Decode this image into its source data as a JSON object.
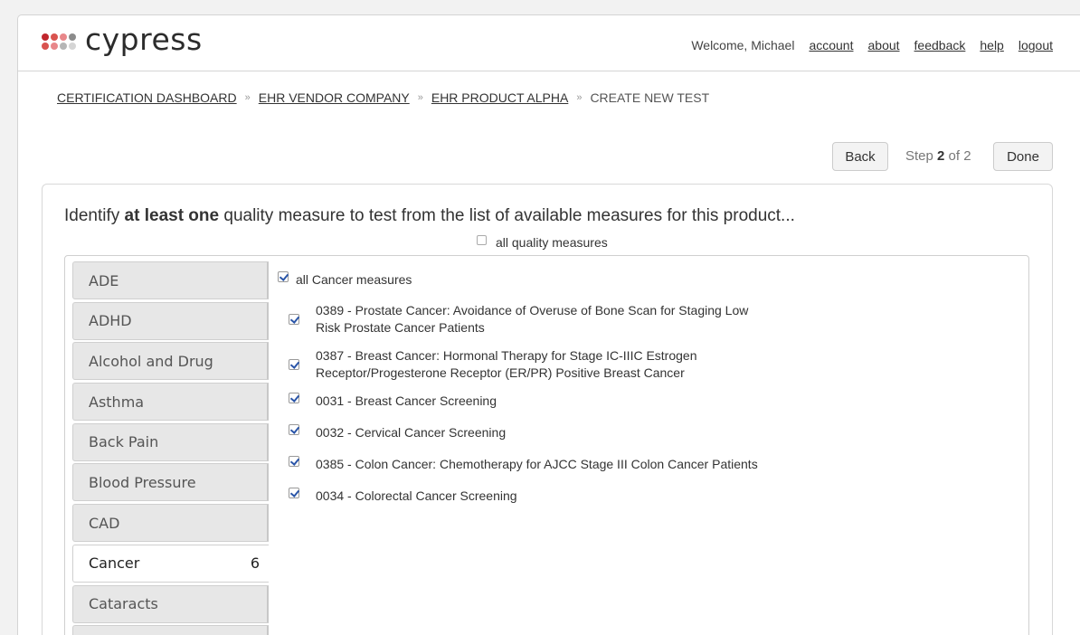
{
  "header": {
    "logo_text": "cypress",
    "logo_dot_colors": [
      "#c1272d",
      "#d9534f",
      "#e8878a",
      "#8b8b8b",
      "#b6b6b6",
      "#d5d5d5"
    ],
    "welcome": "Welcome, Michael",
    "links": [
      "account",
      "about",
      "feedback",
      "help",
      "logout"
    ]
  },
  "breadcrumb": {
    "items": [
      "CERTIFICATION DASHBOARD",
      "EHR VENDOR COMPANY",
      "EHR PRODUCT ALPHA"
    ],
    "current": "CREATE NEW TEST",
    "separator": "»"
  },
  "wizard": {
    "back_label": "Back",
    "step_prefix": "Step",
    "step_current": "2",
    "step_of": "of 2",
    "done_label": "Done"
  },
  "intro": {
    "pre": "Identify",
    "bold": "at least one",
    "post": "quality measure to test from the list of available measures for this product..."
  },
  "all_quality_label": "all quality measures",
  "categories": [
    {
      "name": "ADE",
      "count": ""
    },
    {
      "name": "ADHD",
      "count": ""
    },
    {
      "name": "Alcohol and Drug",
      "count": ""
    },
    {
      "name": "Asthma",
      "count": ""
    },
    {
      "name": "Back Pain",
      "count": ""
    },
    {
      "name": "Blood Pressure",
      "count": ""
    },
    {
      "name": "CAD",
      "count": ""
    },
    {
      "name": "Cancer",
      "count": "6"
    },
    {
      "name": "Cataracts",
      "count": ""
    },
    {
      "name": "",
      "count": ""
    }
  ],
  "measures": {
    "all_label": "all Cancer measures",
    "items": [
      {
        "lines": [
          "0389 - Prostate Cancer: Avoidance of Overuse of Bone Scan for Staging Low",
          "Risk Prostate Cancer Patients"
        ]
      },
      {
        "lines": [
          "0387 - Breast Cancer: Hormonal Therapy for Stage IC-IIIC Estrogen",
          "Receptor/Progesterone Receptor (ER/PR) Positive Breast Cancer"
        ]
      },
      {
        "lines": [
          "0031 - Breast Cancer Screening"
        ]
      },
      {
        "lines": [
          "0032 - Cervical Cancer Screening"
        ]
      },
      {
        "lines": [
          "0385 - Colon Cancer: Chemotherapy for AJCC Stage III Colon Cancer Patients"
        ]
      },
      {
        "lines": [
          "0034 - Colorectal Cancer Screening"
        ]
      }
    ]
  }
}
